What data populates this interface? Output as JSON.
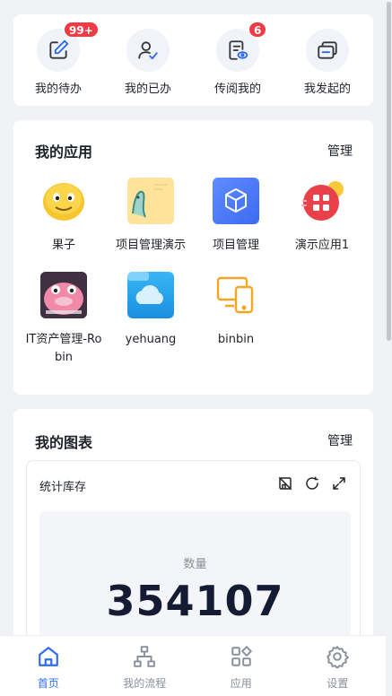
{
  "quick_actions": [
    {
      "label": "我的待办",
      "icon": "edit-icon",
      "badge": "99+"
    },
    {
      "label": "我的已办",
      "icon": "user-check-icon",
      "badge": ""
    },
    {
      "label": "传阅我的",
      "icon": "document-view-icon",
      "badge": "6"
    },
    {
      "label": "我发起的",
      "icon": "cards-icon",
      "badge": ""
    }
  ],
  "apps_section": {
    "title": "我的应用",
    "manage": "管理",
    "items": [
      {
        "label": "果子",
        "icon": "smiley-icon"
      },
      {
        "label": "项目管理演示",
        "icon": "doodle-icon"
      },
      {
        "label": "项目管理",
        "icon": "cube-icon"
      },
      {
        "label": "演示应用1",
        "icon": "grid-app-icon"
      },
      {
        "label": "IT资产管理-Robin",
        "icon": "pink-creature-icon"
      },
      {
        "label": "yehuang",
        "icon": "cloud-folder-icon"
      },
      {
        "label": "binbin",
        "icon": "devices-icon"
      }
    ]
  },
  "charts_section": {
    "title": "我的图表",
    "manage": "管理",
    "chart": {
      "title": "统计库存",
      "stat_label": "数量",
      "stat_value": "354107"
    }
  },
  "bottom_nav": [
    {
      "label": "首页",
      "icon": "home-icon",
      "active": true
    },
    {
      "label": "我的流程",
      "icon": "flow-icon",
      "active": false
    },
    {
      "label": "应用",
      "icon": "apps-icon",
      "active": false
    },
    {
      "label": "设置",
      "icon": "settings-icon",
      "active": false
    }
  ],
  "colors": {
    "accent": "#2f6bf0",
    "badge": "#f03a45",
    "background": "#f1f2f5"
  }
}
